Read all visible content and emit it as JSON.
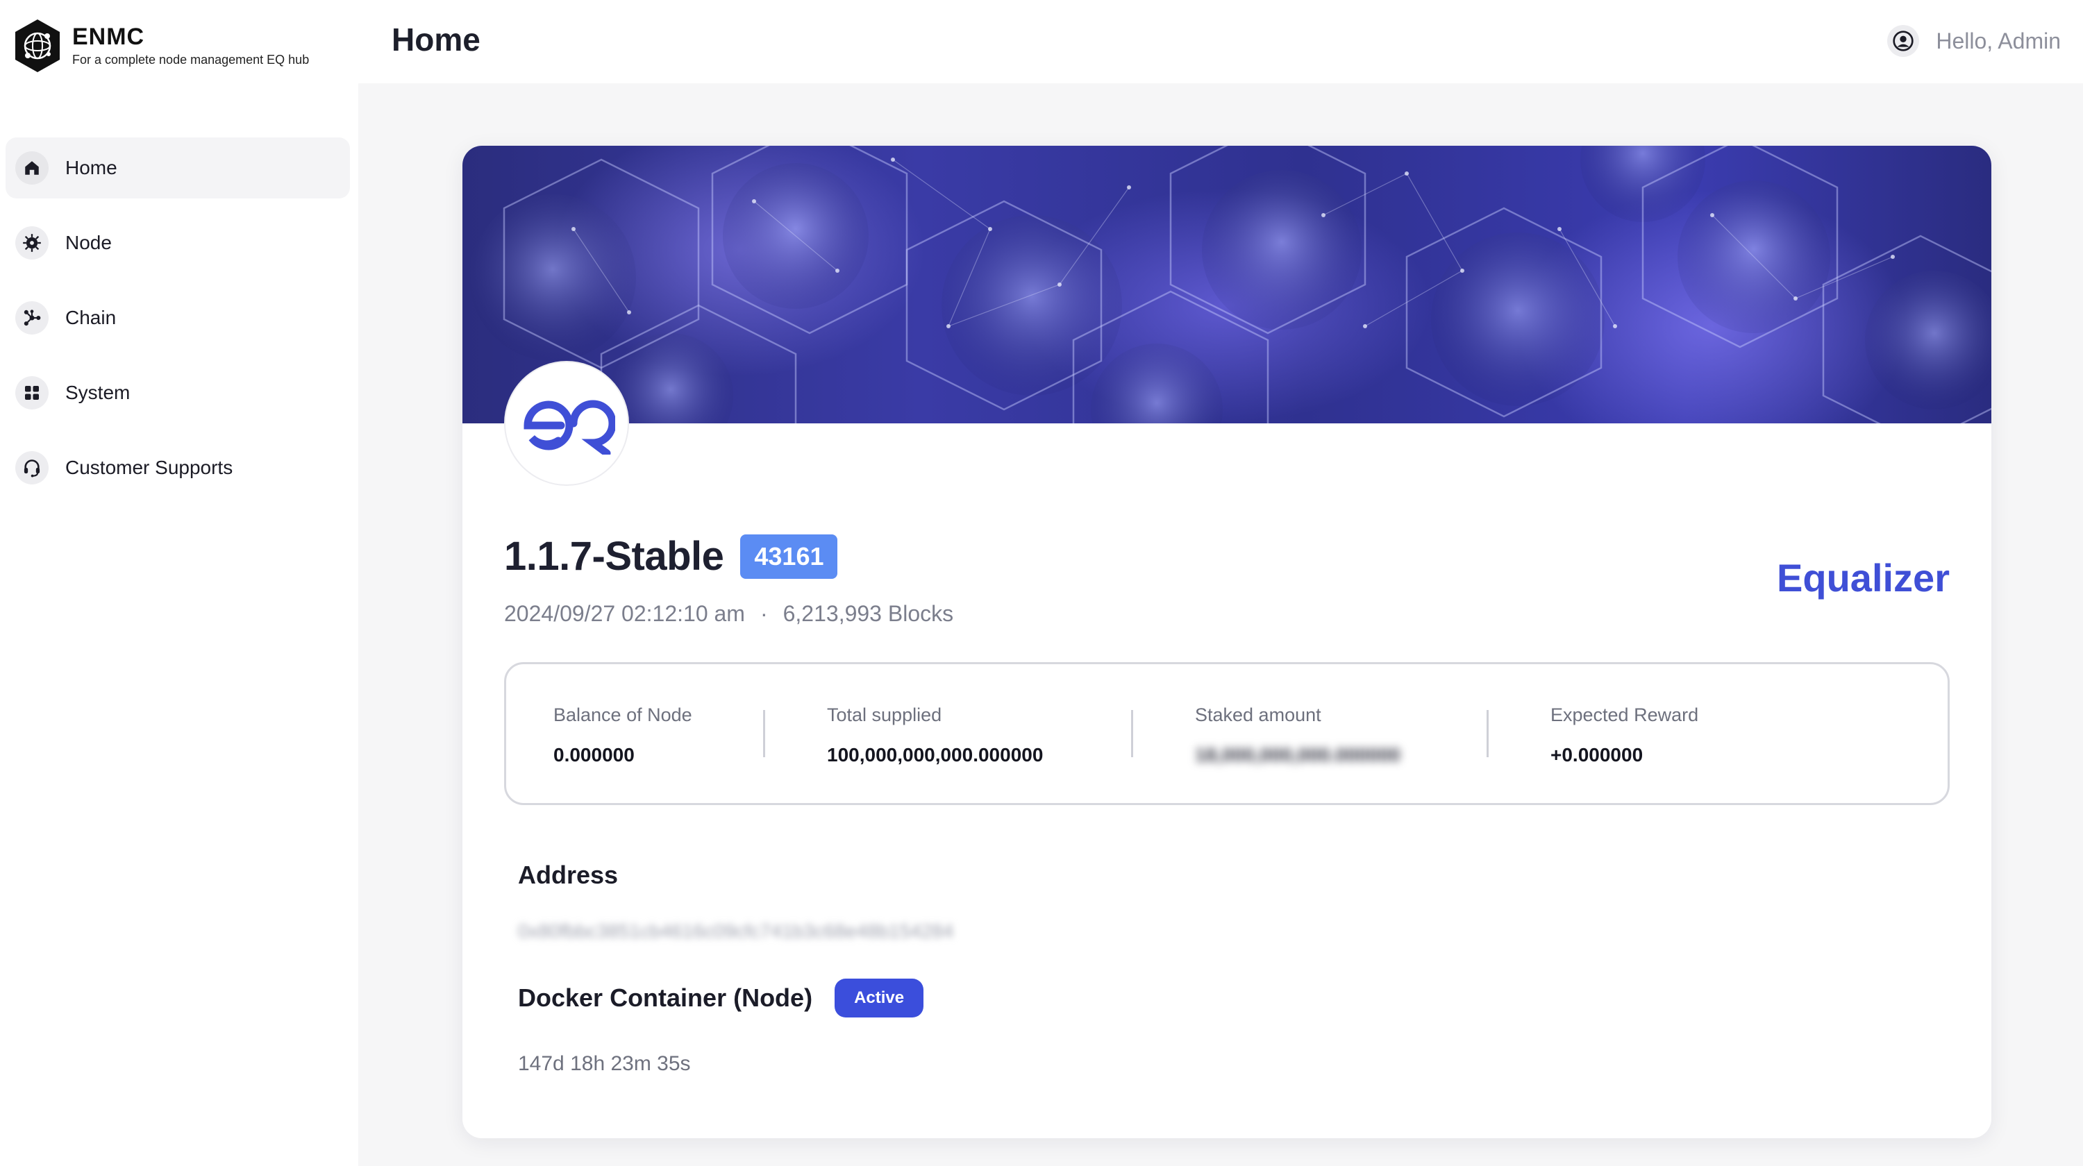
{
  "brand": {
    "name": "ENMC",
    "tagline": "For a complete node management EQ hub"
  },
  "sidebar": {
    "items": [
      {
        "label": "Home",
        "icon": "home-icon",
        "active": true
      },
      {
        "label": "Node",
        "icon": "node-icon",
        "active": false
      },
      {
        "label": "Chain",
        "icon": "chain-icon",
        "active": false
      },
      {
        "label": "System",
        "icon": "grid-icon",
        "active": false
      },
      {
        "label": "Customer Supports",
        "icon": "headset-icon",
        "active": false
      }
    ]
  },
  "header": {
    "title": "Home",
    "user_greeting": "Hello, Admin"
  },
  "node": {
    "version": "1.1.7-Stable",
    "version_badge": "43161",
    "timestamp": "2024/09/27 02:12:10 am",
    "separator": "·",
    "blocks": "6,213,993 Blocks",
    "chain_name": "Equalizer",
    "logo_icon": "eq-logo-icon"
  },
  "stats": [
    {
      "label": "Balance of Node",
      "value": "0.000000",
      "blurred": false
    },
    {
      "label": "Total supplied",
      "value": "100,000,000,000.000000",
      "blurred": false
    },
    {
      "label": "Staked amount",
      "value": "18,000,000,000.000000",
      "blurred": true
    },
    {
      "label": "Expected Reward",
      "value": "+0.000000",
      "blurred": false
    }
  ],
  "address": {
    "title": "Address",
    "value": "0x80fbbc3851cb4616c09cfc741b3c68e48b154284"
  },
  "docker": {
    "title": "Docker Container (Node)",
    "status": "Active",
    "uptime": "147d 18h 23m 35s"
  },
  "colors": {
    "accent": "#3f4fd6",
    "badge_blue": "#5b8cf3",
    "status_active": "#3b4edc",
    "background": "#f6f6f7"
  }
}
